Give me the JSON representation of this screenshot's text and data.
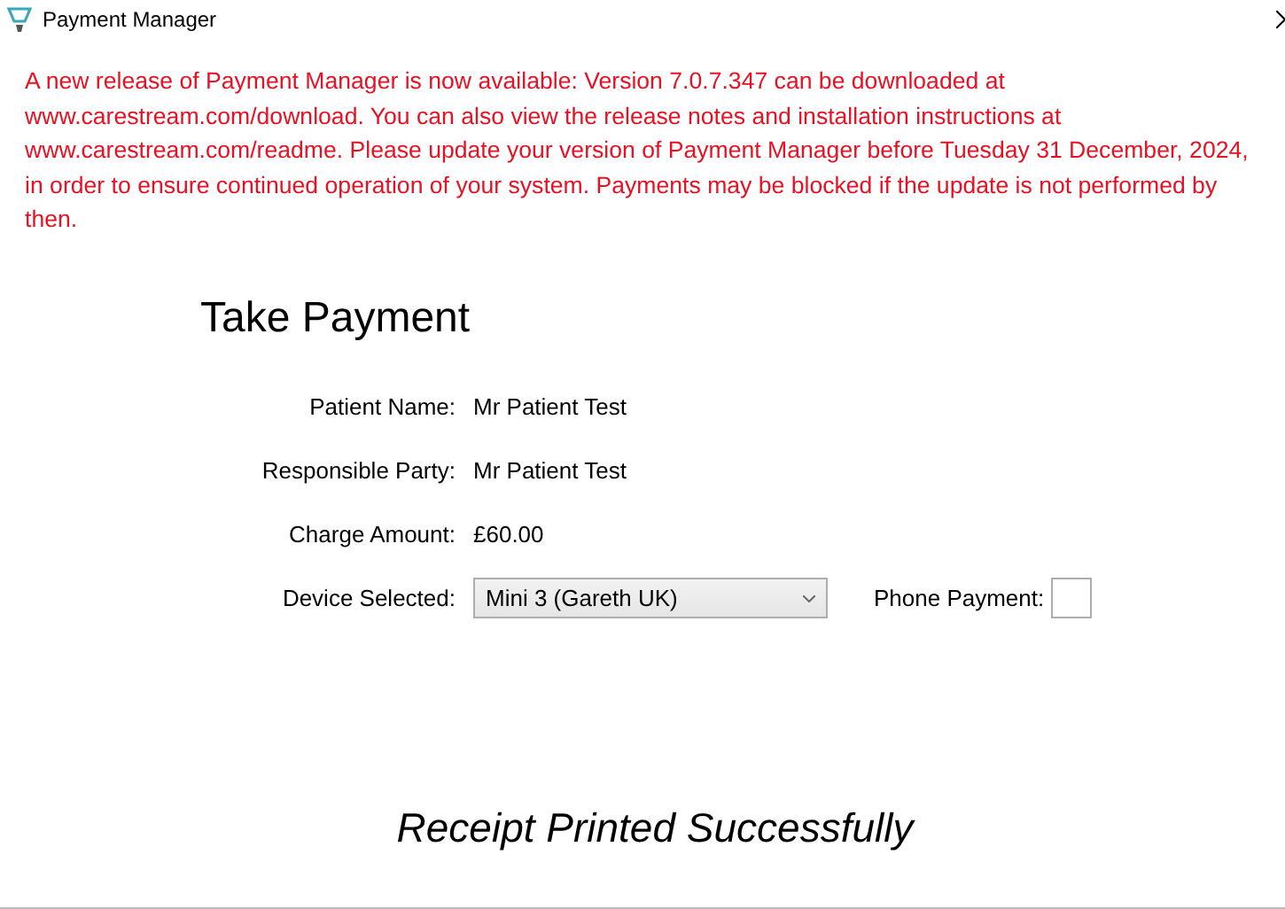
{
  "window": {
    "title": "Payment Manager"
  },
  "notice": "A new release of Payment Manager is now available: Version 7.0.7.347 can be downloaded at www.carestream.com/download. You can also view the release notes and installation instructions at www.carestream.com/readme. Please update your version of Payment Manager before Tuesday 31 December, 2024, in order to ensure continued operation of your system. Payments may be blocked if the update is not performed by then.",
  "heading": "Take Payment",
  "fields": [
    {
      "label": "Patient Name:",
      "value": "Mr Patient Test"
    },
    {
      "label": "Responsible Party:",
      "value": "Mr Patient Test"
    },
    {
      "label": "Charge Amount:",
      "value": "£60.00"
    }
  ],
  "device": {
    "label": "Device Selected:",
    "value": "Mini 3 (Gareth UK)"
  },
  "phone_payment": {
    "label": "Phone Payment:",
    "checked": false
  },
  "status": "Receipt Printed Successfully"
}
